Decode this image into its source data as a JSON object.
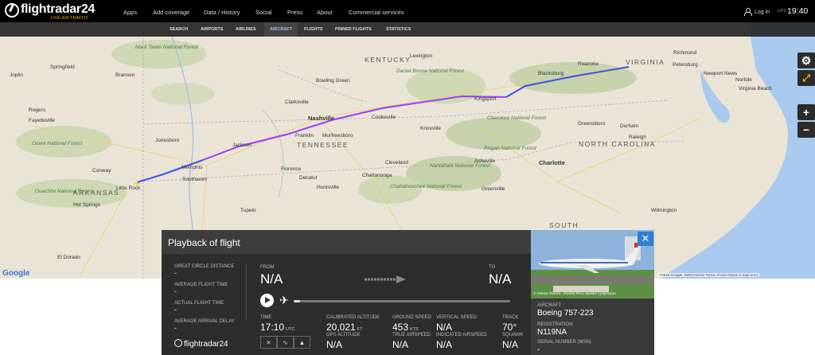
{
  "header": {
    "logo_text": "flightradar24",
    "logo_tagline": "LIVE AIR TRAFFIC",
    "nav": [
      "Apps",
      "Add coverage",
      "Data / History",
      "Social",
      "Press",
      "About",
      "Commercial services"
    ],
    "login_label": "Log in",
    "timezone": "UTC",
    "time": "19:40"
  },
  "subnav": [
    "SEARCH",
    "AIRPORTS",
    "AIRLINES",
    "AIRCRAFT",
    "FLIGHTS",
    "PINNED FLIGHTS",
    "STATISTICS"
  ],
  "subnav_active": "AIRCRAFT",
  "map": {
    "places": [
      "KENTUCKY",
      "VIRGINIA",
      "TENNESSEE",
      "ARKANSAS",
      "NORTH CAROLINA",
      "SOUTH",
      "Nashville",
      "Knoxville",
      "Charlotte",
      "Memphis",
      "Jackson",
      "Chattanooga",
      "Huntsville",
      "Richmond",
      "Raleigh",
      "Greensboro",
      "Roanoke",
      "Lexington",
      "Bowling Green",
      "Clarksville",
      "Springfield",
      "Jonesboro",
      "Little Rock",
      "Conway",
      "Hot Springs",
      "Fayetteville",
      "Tupelo",
      "Asheville",
      "Greenville",
      "Durham",
      "Wilmington",
      "Newport News",
      "Norfolk",
      "Virginia Beach",
      "Petersburg",
      "Blacksburg",
      "Kingsport",
      "Franklin",
      "Murfreesboro",
      "Cookeville",
      "Cleveland",
      "Florence",
      "Decatur",
      "Southaven",
      "El Dorado",
      "Rogers",
      "Joplin",
      "Branson",
      "Mark Twain National Forest",
      "Ozark National Forest",
      "Ouachita National Forest",
      "Daniel Boone National Forest",
      "Cherokee National Forest",
      "Pisgah National Forest",
      "Nantahala National Forest",
      "Chattahoochee National Forest"
    ],
    "attribution": "©2018 Google, INEGI  50 km  Terms of Use  Report a map error",
    "google_label": "Google",
    "controls": [
      "gear-icon",
      "fullscreen-icon",
      "zoom-in",
      "zoom-out"
    ]
  },
  "panel": {
    "title": "Playback of flight",
    "stats": [
      {
        "label": "GREAT CIRCLE DISTANCE",
        "value": "-"
      },
      {
        "label": "AVERAGE FLIGHT TIME",
        "value": "-"
      },
      {
        "label": "ACTUAL FLIGHT TIME",
        "value": "-"
      },
      {
        "label": "AVERAGE ARRIVAL DELAY",
        "value": "-"
      }
    ],
    "from_label": "FROM",
    "from_value": "N/A",
    "to_label": "TO",
    "to_value": "N/A",
    "playback_progress": 0.03,
    "time_label": "TIME",
    "time_value": "17:10",
    "time_unit": "UTC",
    "cal_alt_label": "CALIBRATED ALTITUDE",
    "cal_alt_value": "20,021",
    "cal_alt_unit": "FT",
    "gps_alt_label": "GPS ALTITUDE",
    "gps_alt_value": "N/A",
    "ground_speed_label": "GROUND SPEED",
    "ground_speed_value": "453",
    "ground_speed_unit": "KTS",
    "true_airspeed_label": "TRUE AIRSPEED",
    "true_airspeed_value": "N/A",
    "vertical_speed_label": "VERTICAL SPEED",
    "vertical_speed_value": "N/A",
    "indicated_airspeed_label": "INDICATED AIRSPEED",
    "indicated_airspeed_value": "N/A",
    "track_label": "TRACK",
    "track_value": "70°",
    "squawk_label": "SQUAWK",
    "squawk_value": "N/A",
    "brand": "flightradar24"
  },
  "aircraft_info": {
    "photo_credit": "© Hector Rivera - Puerto Rico Spotter | jetphotos",
    "aircraft_label": "AIRCRAFT",
    "aircraft_value": "Boeing 757-223",
    "registration_label": "REGISTRATION",
    "registration_value": "N119NA",
    "msn_label": "SERIAL NUMBER (MSN)",
    "msn_value": "-"
  },
  "colors": {
    "track_purple": "#9b3ff5",
    "track_blue": "#3d55e6",
    "accent_blue": "#2f7fd0",
    "panel_bg": "#2d2d2d"
  }
}
